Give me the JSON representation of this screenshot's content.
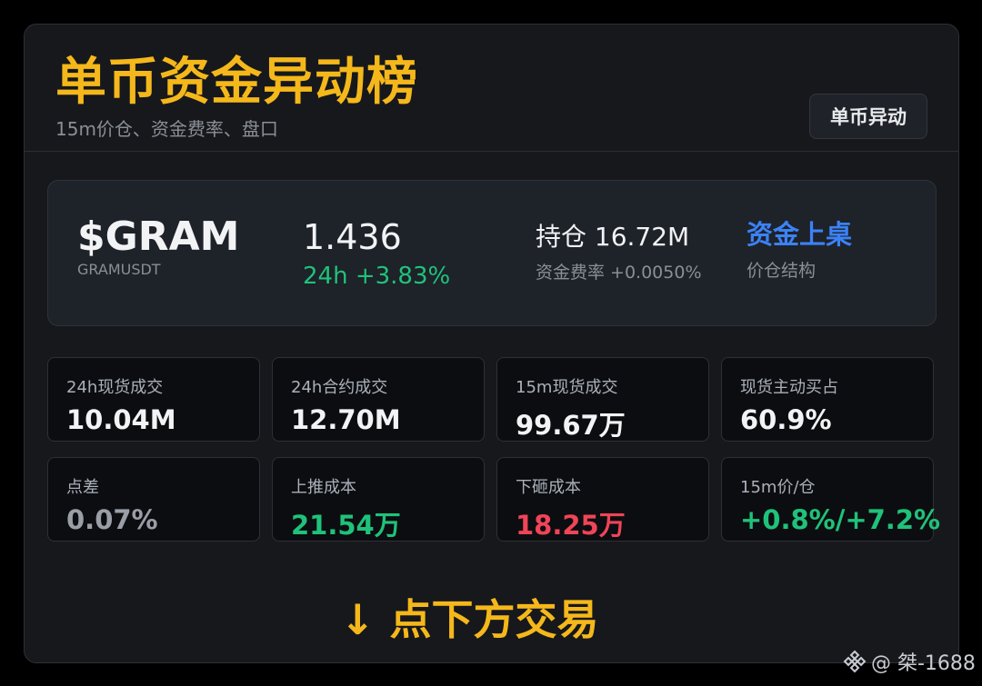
{
  "header": {
    "title": "单币资金异动榜",
    "subtitle": "15m价仓、资金费率、盘口",
    "tag_button": "单币异动"
  },
  "hero": {
    "symbol": "$GRAM",
    "pair": "GRAMUSDT",
    "price": "1.436",
    "change": "24h +3.83%",
    "open_interest": "持仓 16.72M",
    "funding_rate": "资金费率 +0.0050%",
    "flow_link": "资金上桌",
    "structure": "价仓结构"
  },
  "stats": [
    {
      "label": "24h现货成交",
      "value": "10.04M"
    },
    {
      "label": "24h合约成交",
      "value": "12.70M"
    },
    {
      "label": "15m现货成交",
      "value": "99.67万"
    },
    {
      "label": "现货主动买占",
      "value": "60.9%"
    },
    {
      "label": "点差",
      "value": "0.07%"
    },
    {
      "label": "上推成本",
      "value": "21.54万"
    },
    {
      "label": "下砸成本",
      "value": "18.25万"
    },
    {
      "label": "15m价/仓",
      "value": "+0.8%/+7.2%"
    }
  ],
  "colors": {
    "accent_gold": "#f5b81b",
    "positive_green": "#1fc27a",
    "negative_red": "#f04458",
    "link_blue": "#3b82f6"
  },
  "cta": "↓ 点下方交易",
  "watermark": {
    "icon": "binance-diamond-icon",
    "text": "@ 桀-1688"
  }
}
